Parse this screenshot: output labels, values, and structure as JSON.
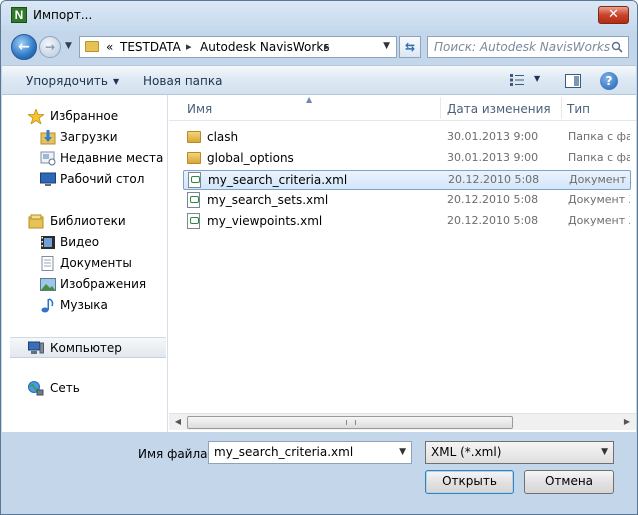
{
  "window": {
    "title": "Импорт...",
    "app_icon_letter": "N",
    "close_glyph": "✕"
  },
  "nav": {
    "back_glyph": "←",
    "forward_glyph": "→",
    "path_prefix": "«",
    "path": [
      "TESTDATA",
      "Autodesk NavisWorks"
    ],
    "separator": "▸",
    "search_placeholder": "Поиск: Autodesk NavisWorks"
  },
  "commands": {
    "organize": "Упорядочить",
    "new_folder": "Новая папка",
    "help_glyph": "?"
  },
  "sidebar": {
    "favorites": {
      "label": "Избранное",
      "items": [
        "Загрузки",
        "Недавние места",
        "Рабочий стол"
      ]
    },
    "libraries": {
      "label": "Библиотеки",
      "items": [
        "Видео",
        "Документы",
        "Изображения",
        "Музыка"
      ]
    },
    "computer": "Компьютер",
    "network": "Сеть"
  },
  "columns": {
    "name": "Имя",
    "date": "Дата изменения",
    "type": "Тип"
  },
  "files": [
    {
      "name": "clash",
      "date": "30.01.2013 9:00",
      "type": "Папка с фай",
      "kind": "folder"
    },
    {
      "name": "global_options",
      "date": "30.01.2013 9:00",
      "type": "Папка с фай",
      "kind": "folder"
    },
    {
      "name": "my_search_criteria.xml",
      "date": "20.12.2010 5:08",
      "type": "Документ X",
      "kind": "xml",
      "selected": true
    },
    {
      "name": "my_search_sets.xml",
      "date": "20.12.2010 5:08",
      "type": "Документ X",
      "kind": "xml"
    },
    {
      "name": "my_viewpoints.xml",
      "date": "20.12.2010 5:08",
      "type": "Документ X",
      "kind": "xml"
    }
  ],
  "bottom": {
    "filename_label": "Имя файла:",
    "filename_value": "my_search_criteria.xml",
    "filter_value": "XML (*.xml)",
    "open_button": "Открыть",
    "cancel_button": "Отмена"
  }
}
